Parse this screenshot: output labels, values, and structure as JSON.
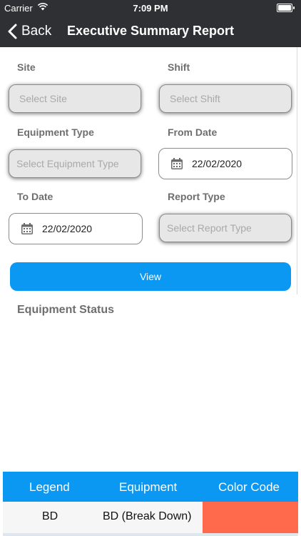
{
  "status_bar": {
    "carrier": "Carrier",
    "time": "7:09 PM"
  },
  "nav": {
    "back_label": "Back",
    "title": "Executive Summary Report"
  },
  "form": {
    "site": {
      "label": "Site",
      "placeholder": "Select Site"
    },
    "shift": {
      "label": "Shift",
      "placeholder": "Select Shift"
    },
    "equipment_type": {
      "label": "Equipment Type",
      "placeholder": "Select Equipment Type"
    },
    "from_date": {
      "label": "From Date",
      "value": "22/02/2020"
    },
    "to_date": {
      "label": "To Date",
      "value": "22/02/2020"
    },
    "report_type": {
      "label": "Report Type",
      "placeholder": "Select Report Type"
    },
    "view_button": "View"
  },
  "section": {
    "equipment_status": "Equipment Status"
  },
  "legend_table": {
    "headers": [
      "Legend",
      "Equipment",
      "Color Code"
    ],
    "rows": [
      {
        "legend": "BD",
        "equipment": "BD (Break Down)",
        "color": "#ff6a4d"
      }
    ]
  },
  "colors": {
    "nav_bg": "#2f3033",
    "accent": "#0a98f3"
  },
  "icons": {
    "back": "chevron-left-icon",
    "calendar": "calendar-icon",
    "wifi": "wifi-icon",
    "battery": "battery-icon"
  }
}
